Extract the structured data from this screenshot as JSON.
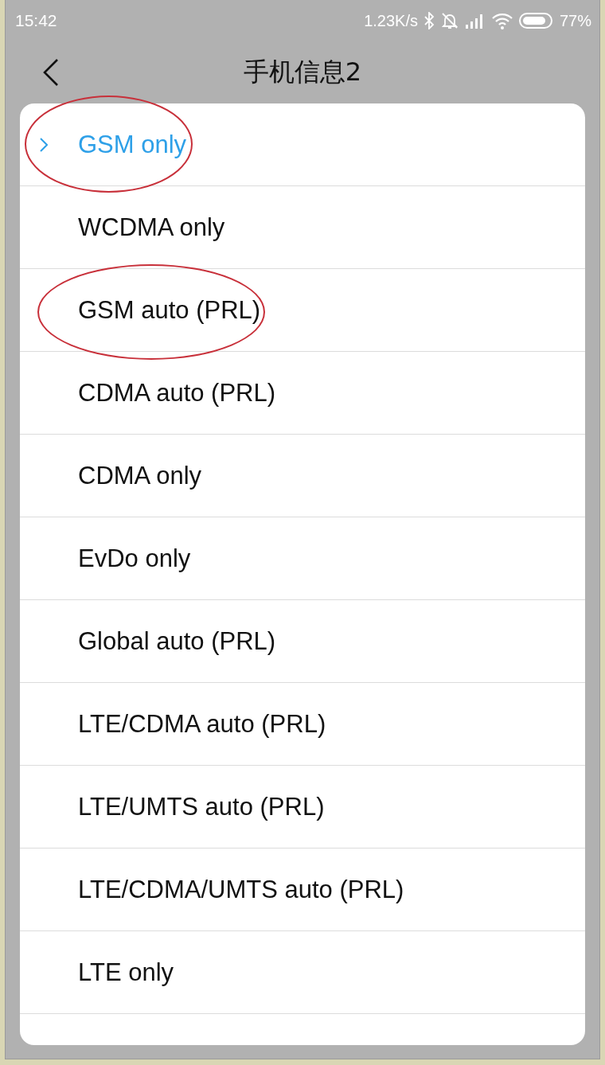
{
  "status_bar": {
    "time": "15:42",
    "net_speed": "1.23K/s",
    "battery": "77%"
  },
  "title_bar": {
    "title": "手机信息2"
  },
  "dialog": {
    "options": [
      {
        "label": "GSM only",
        "selected": true,
        "annotated": true
      },
      {
        "label": "WCDMA only",
        "selected": false,
        "annotated": false
      },
      {
        "label": "GSM auto (PRL)",
        "selected": false,
        "annotated": true
      },
      {
        "label": "CDMA auto (PRL)",
        "selected": false,
        "annotated": false
      },
      {
        "label": "CDMA only",
        "selected": false,
        "annotated": false
      },
      {
        "label": "EvDo only",
        "selected": false,
        "annotated": false
      },
      {
        "label": "Global auto (PRL)",
        "selected": false,
        "annotated": false
      },
      {
        "label": "LTE/CDMA auto (PRL)",
        "selected": false,
        "annotated": false
      },
      {
        "label": "LTE/UMTS auto (PRL)",
        "selected": false,
        "annotated": false
      },
      {
        "label": "LTE/CDMA/UMTS auto (PRL)",
        "selected": false,
        "annotated": false
      },
      {
        "label": "LTE only",
        "selected": false,
        "annotated": false
      }
    ]
  }
}
